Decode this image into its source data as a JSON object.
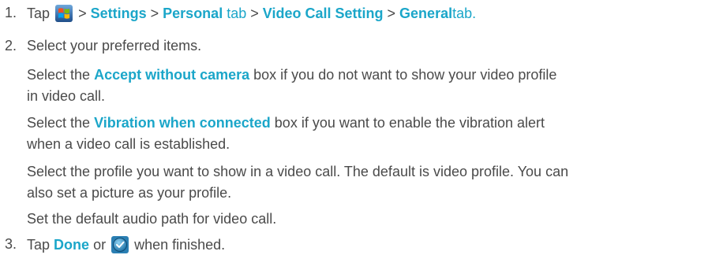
{
  "steps": [
    {
      "number": "1.",
      "parts": {
        "tap": "Tap",
        "sep1": ">",
        "settings": "Settings",
        "sep2": ">",
        "personal": "Personal",
        "tab1": "tab",
        "sep3": ">",
        "video_call_setting": "Video Call Setting",
        "sep4": ">",
        "general": "General",
        "tab2": "tab."
      },
      "icon": "windows-start-icon"
    },
    {
      "number": "2.",
      "text": "Select your preferred items.",
      "sub": [
        {
          "pre": "Select the",
          "kw": "Accept without camera",
          "post": "box if you do not want to show your video profile in video call."
        },
        {
          "pre": "Select the",
          "kw": "Vibration when connected",
          "post": "box if you want to enable the vibration alert when a video call is established."
        },
        {
          "text": "Select the profile you want to show in a video call. The default is video profile. You can also set a picture as your profile."
        },
        {
          "text": "Set the default audio path for video call."
        }
      ]
    },
    {
      "number": "3.",
      "parts": {
        "tap": "Tap",
        "done": "Done",
        "or": "or",
        "finished": "when finished."
      },
      "icon": "ok-button-icon"
    }
  ],
  "colors": {
    "text": "#4a4a4a",
    "keyword": "#1ba6c9"
  }
}
